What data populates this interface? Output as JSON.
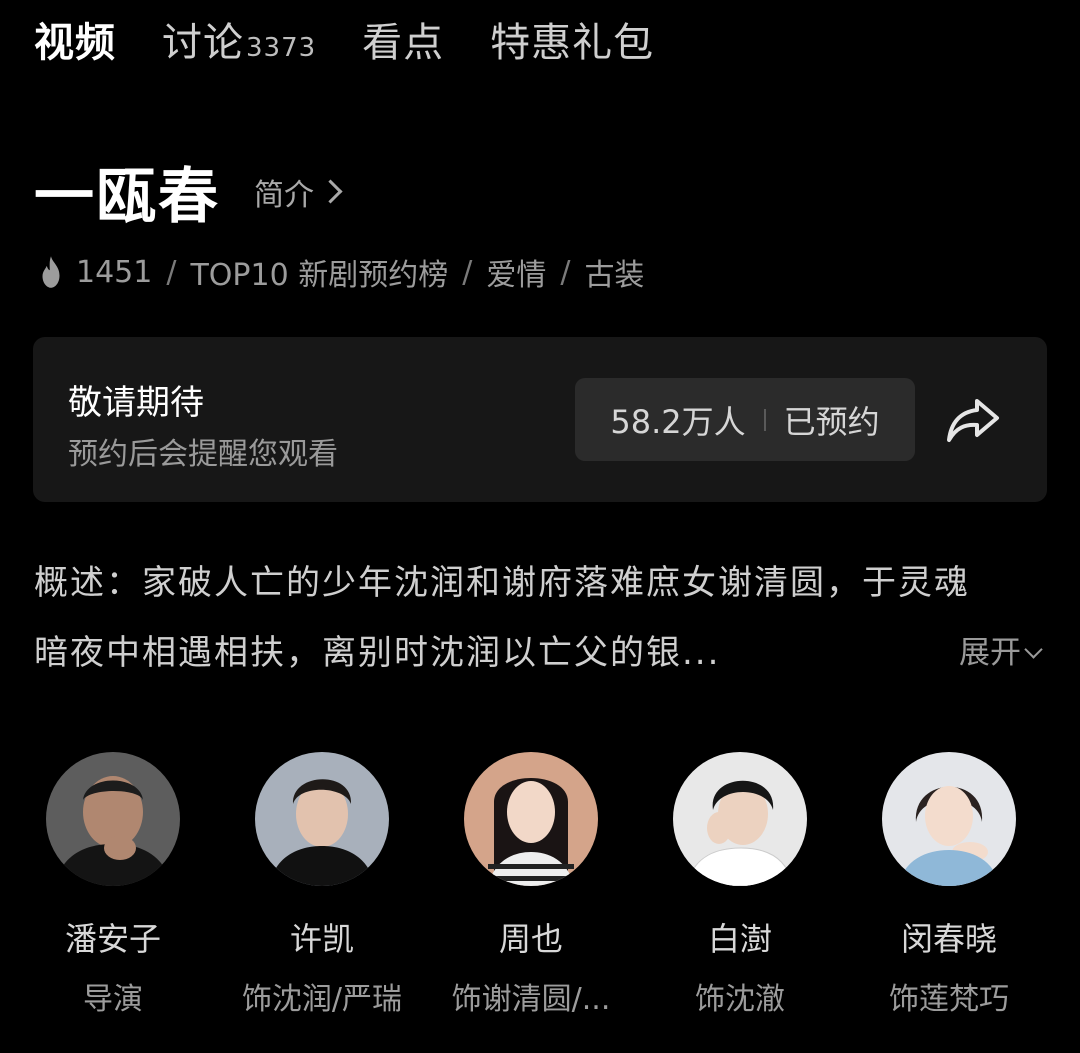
{
  "tabs": [
    {
      "label": "视频"
    },
    {
      "label": "讨论",
      "count": "3373"
    },
    {
      "label": "看点"
    },
    {
      "label": "特惠礼包"
    }
  ],
  "show": {
    "title": "一瓯春",
    "intro_link": "简介",
    "heat": "1451",
    "ranking": "TOP10 新剧预约榜",
    "genres": [
      "爱情",
      "古装"
    ]
  },
  "reservation": {
    "headline": "敬请期待",
    "subtext": "预约后会提醒您观看",
    "count": "58.2万人",
    "status": "已预约"
  },
  "description": {
    "line1": "概述：家破人亡的少年沈润和谢府落难庶女谢清圆，于灵魂",
    "line2": "暗夜中相遇相扶，离别时沈润以亡父的银...",
    "expand": "展开"
  },
  "cast": [
    {
      "name": "潘安子",
      "role": "导演"
    },
    {
      "name": "许凯",
      "role": "饰沈润/严瑞"
    },
    {
      "name": "周也",
      "role": "饰谢清圆/..."
    },
    {
      "name": "白澍",
      "role": "饰沈澈"
    },
    {
      "name": "闵春晓",
      "role": "饰莲梵巧"
    }
  ],
  "colors": {
    "background": "#000000",
    "card": "#171717",
    "button": "#2b2b2b"
  }
}
